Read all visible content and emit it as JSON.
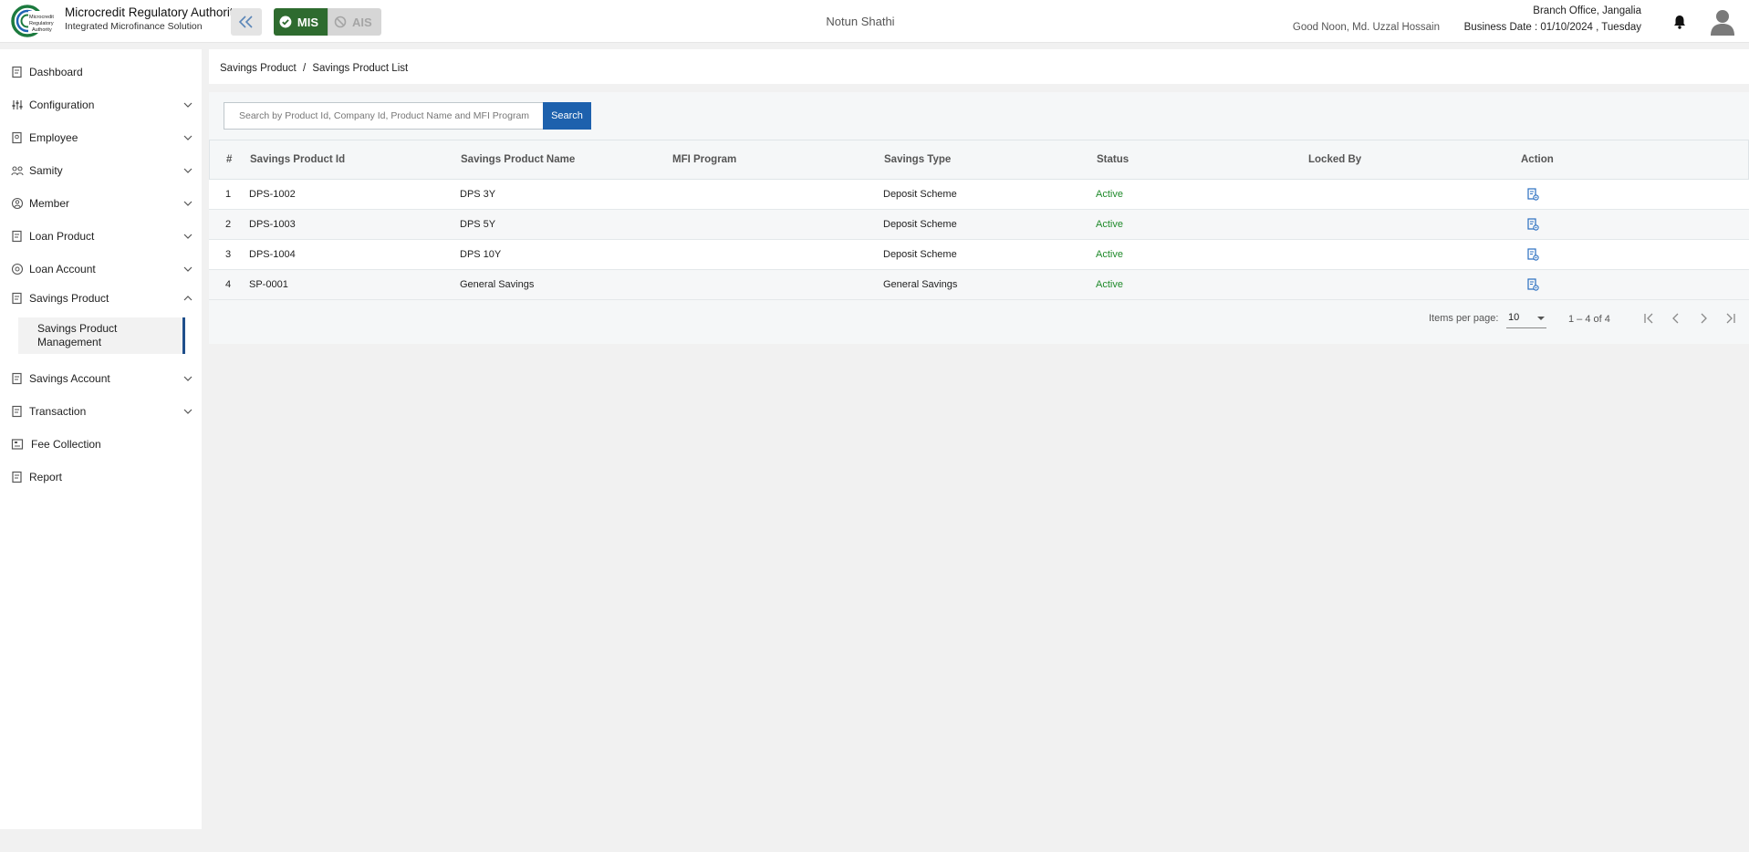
{
  "header": {
    "org_name": "Microcredit Regulatory Authority",
    "org_sub": "Integrated Microfinance Solution",
    "logo_text": "Microcredit Regulatory Authority",
    "mode_mis": "MIS",
    "mode_ais": "AIS",
    "app_title": "Notun Shathi",
    "greeting": "Good Noon, Md. Uzzal Hossain",
    "branch": "Branch Office, Jangalia",
    "business_date": "Business Date : 01/10/2024 , Tuesday"
  },
  "sidebar": {
    "items": [
      {
        "label": "Dashboard",
        "icon": "dashboard-icon",
        "expandable": false
      },
      {
        "label": "Configuration",
        "icon": "sliders-icon",
        "expandable": true
      },
      {
        "label": "Employee",
        "icon": "employee-icon",
        "expandable": true
      },
      {
        "label": "Samity",
        "icon": "group-icon",
        "expandable": true
      },
      {
        "label": "Member",
        "icon": "member-icon",
        "expandable": true
      },
      {
        "label": "Loan Product",
        "icon": "document-icon",
        "expandable": true
      },
      {
        "label": "Loan Account",
        "icon": "account-icon",
        "expandable": true
      },
      {
        "label": "Savings Product",
        "icon": "document-icon",
        "expandable": true,
        "expanded": true
      },
      {
        "label": "Savings Account",
        "icon": "document-icon",
        "expandable": true
      },
      {
        "label": "Transaction",
        "icon": "document-icon",
        "expandable": true
      },
      {
        "label": "Fee Collection",
        "icon": "cash-register-icon",
        "expandable": false
      },
      {
        "label": "Report",
        "icon": "report-icon",
        "expandable": false
      }
    ],
    "active_sub_item": "Savings Product Management"
  },
  "breadcrumb": {
    "parent": "Savings Product",
    "separator": "/",
    "current": "Savings Product List"
  },
  "search": {
    "placeholder": "Search by Product Id, Company Id, Product Name and MFI Program",
    "value": "",
    "button_label": "Search"
  },
  "table": {
    "columns": [
      "#",
      "Savings Product Id",
      "Savings Product Name",
      "MFI Program",
      "Savings Type",
      "Status",
      "Locked By",
      "Action"
    ],
    "rows": [
      {
        "no": "1",
        "id": "DPS-1002",
        "name": "DPS 3Y",
        "mfi": "",
        "type": "Deposit Scheme",
        "status": "Active",
        "locked_by": ""
      },
      {
        "no": "2",
        "id": "DPS-1003",
        "name": "DPS 5Y",
        "mfi": "",
        "type": "Deposit Scheme",
        "status": "Active",
        "locked_by": ""
      },
      {
        "no": "3",
        "id": "DPS-1004",
        "name": "DPS 10Y",
        "mfi": "",
        "type": "Deposit Scheme",
        "status": "Active",
        "locked_by": ""
      },
      {
        "no": "4",
        "id": "SP-0001",
        "name": "General Savings",
        "mfi": "",
        "type": "General Savings",
        "status": "Active",
        "locked_by": ""
      }
    ],
    "action_icon": "view-document-icon"
  },
  "paginator": {
    "items_per_page_label": "Items per page:",
    "items_per_page": "10",
    "range_label": "1 – 4 of 4"
  },
  "colors": {
    "mis_active": "#2e6b2f",
    "search_button": "#1d61ad",
    "status_active": "#1f8a2a",
    "sidebar_active_marker": "#1f4f8b"
  }
}
